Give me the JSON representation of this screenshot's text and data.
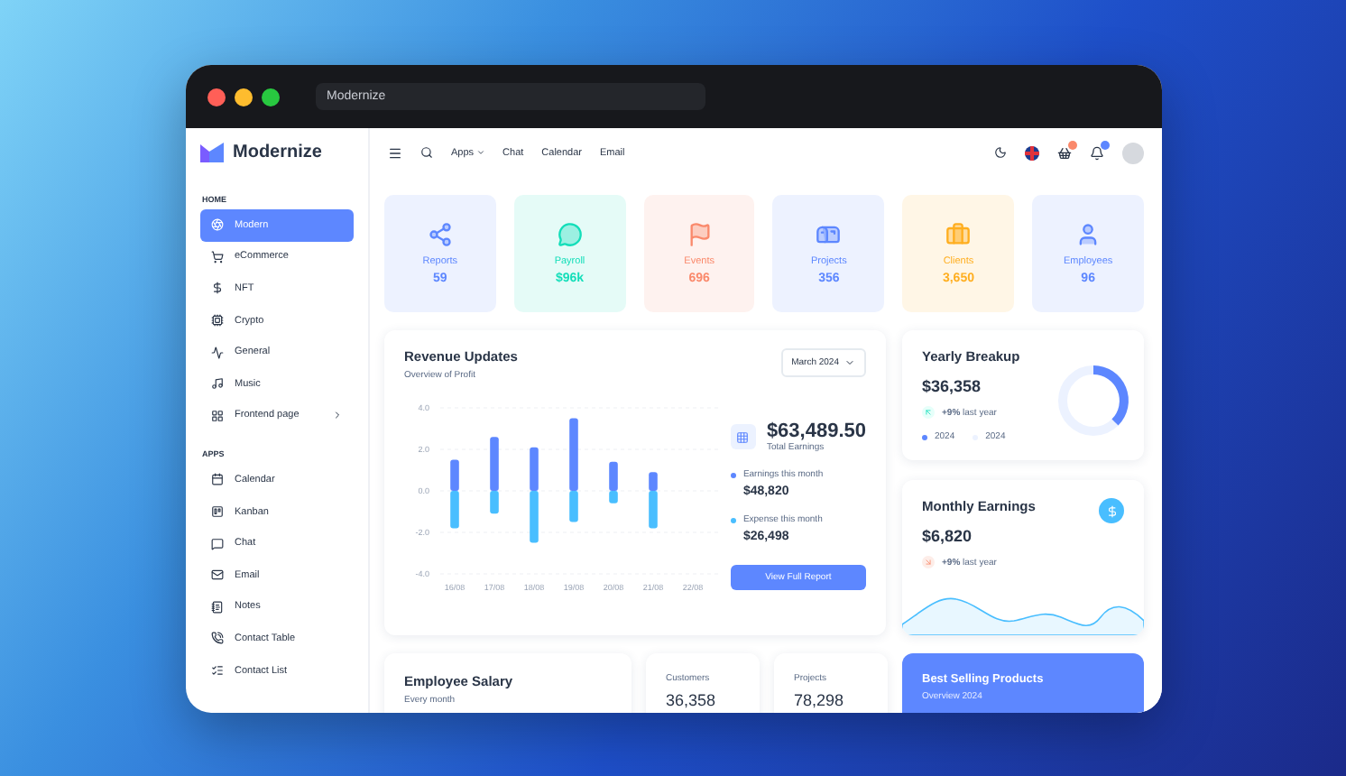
{
  "browser": {
    "address": "Modernize"
  },
  "brand": {
    "name": "Modernize"
  },
  "sidebar": {
    "sections": [
      {
        "label": "HOME",
        "items": [
          {
            "label": "Modern",
            "selected": true,
            "kind": "link"
          },
          {
            "label": "eCommerce",
            "selected": false,
            "kind": "link"
          },
          {
            "label": "NFT",
            "selected": false,
            "kind": "link"
          },
          {
            "label": "Crypto",
            "selected": false,
            "kind": "link"
          },
          {
            "label": "General",
            "selected": false,
            "kind": "link"
          },
          {
            "label": "Music",
            "selected": false,
            "kind": "link"
          },
          {
            "label": "Frontend page",
            "selected": false,
            "kind": "group"
          }
        ]
      },
      {
        "label": "APPS",
        "items": [
          {
            "label": "Calendar",
            "selected": false,
            "kind": "link"
          },
          {
            "label": "Kanban",
            "selected": false,
            "kind": "link"
          },
          {
            "label": "Chat",
            "selected": false,
            "kind": "link"
          },
          {
            "label": "Email",
            "selected": false,
            "kind": "link"
          },
          {
            "label": "Notes",
            "selected": false,
            "kind": "link"
          },
          {
            "label": "Contact Table",
            "selected": false,
            "kind": "link"
          },
          {
            "label": "Contact List",
            "selected": false,
            "kind": "link"
          }
        ]
      }
    ]
  },
  "topbar": {
    "nav": [
      {
        "label": "Apps",
        "kind": "menu"
      },
      {
        "label": "Chat",
        "kind": "link"
      },
      {
        "label": "Calendar",
        "kind": "link"
      },
      {
        "label": "Email",
        "kind": "link"
      }
    ]
  },
  "stats": [
    {
      "label": "Reports",
      "value": "59",
      "color": "#5d87ff"
    },
    {
      "label": "Payroll",
      "value": "$96k",
      "color": "#13deb9"
    },
    {
      "label": "Events",
      "value": "696",
      "color": "#fa896b"
    },
    {
      "label": "Projects",
      "value": "356",
      "color": "#5d87ff"
    },
    {
      "label": "Clients",
      "value": "3,650",
      "color": "#ffae1f"
    },
    {
      "label": "Employees",
      "value": "96",
      "color": "#5d87ff"
    }
  ],
  "revenue": {
    "title": "Revenue Updates",
    "subtitle": "Overview of Profit",
    "period": "March 2024",
    "chart_data": {
      "type": "bar",
      "stacked": true,
      "grid": true,
      "categories": [
        "16/08",
        "17/08",
        "18/08",
        "19/08",
        "20/08",
        "21/08",
        "22/08"
      ],
      "series": [
        {
          "color": "#5d87ff",
          "values": [
            1.5,
            2.6,
            2.1,
            3.5,
            1.4,
            0.9,
            null
          ]
        },
        {
          "color": "#49beff",
          "values": [
            -1.8,
            -1.1,
            -2.5,
            -1.5,
            -0.6,
            -1.8,
            null
          ]
        }
      ],
      "ylim": [
        -4,
        4
      ],
      "yticks": [
        {
          "value": 4,
          "label": "4.0"
        },
        {
          "value": 2,
          "label": "2.0"
        },
        {
          "value": 0,
          "label": "0.0"
        },
        {
          "value": -2,
          "label": "-2.0"
        },
        {
          "value": -4,
          "label": "-4.0"
        }
      ]
    },
    "total": "$63,489.50",
    "total_label": "Total Earnings",
    "breakdown": [
      {
        "label": "Earnings this month",
        "value": "$48,820",
        "color": "#5d87ff"
      },
      {
        "label": "Expense this month",
        "value": "$26,498",
        "color": "#49beff"
      }
    ],
    "button": "View Full Report"
  },
  "yearly": {
    "title": "Yearly Breakup",
    "value": "$36,358",
    "rising": true,
    "change": "**+9%** last year",
    "legend": [
      {
        "label": "2024",
        "color": "#5d87ff"
      },
      {
        "label": "2024",
        "color": "#ecf2ff"
      }
    ]
  },
  "monthly": {
    "title": "Monthly Earnings",
    "value": "$6,820",
    "rising": false,
    "change": "**+9%** last year"
  },
  "salary": {
    "title": "Employee Salary",
    "subtitle": "Every month"
  },
  "counters": [
    {
      "label": "Customers",
      "value": "36,358"
    },
    {
      "label": "Projects",
      "value": "78,298"
    }
  ],
  "best_selling": {
    "title": "Best Selling Products",
    "subtitle": "Overview 2024"
  }
}
